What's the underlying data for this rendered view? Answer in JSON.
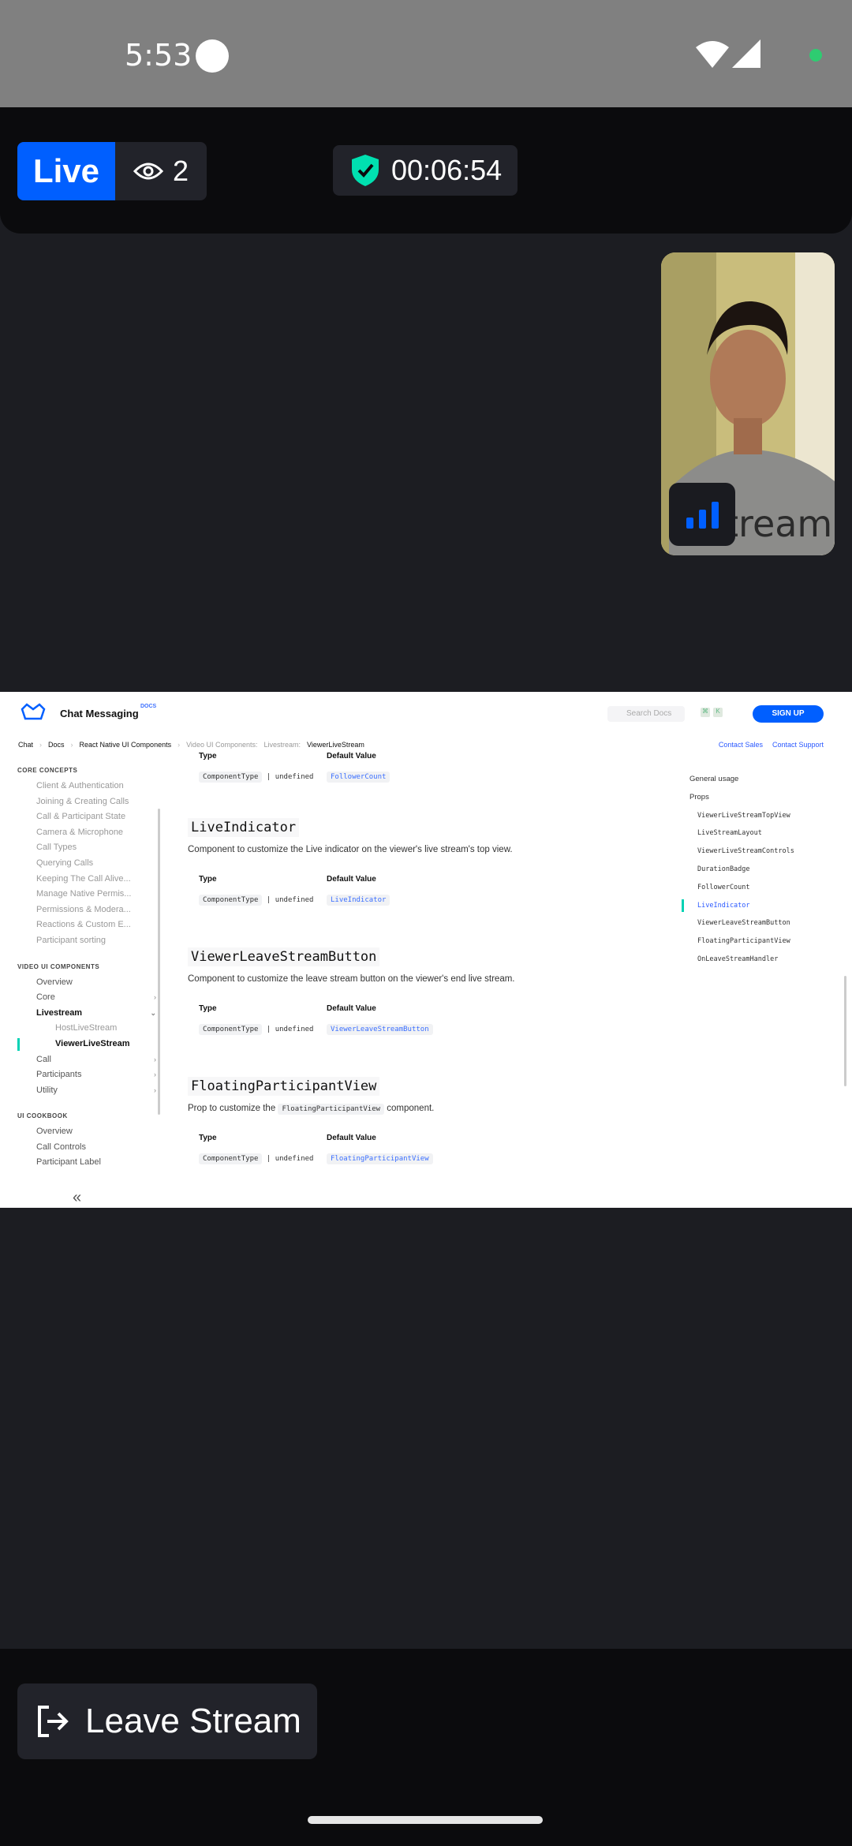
{
  "status_bar": {
    "time": "5:53"
  },
  "stream_header": {
    "live_label": "Live",
    "viewer_count": "2",
    "duration": "00:06:54"
  },
  "self_view": {
    "network_icon": "signal-bars-icon"
  },
  "shared_screen": {
    "brand": "Chat Messaging",
    "brand_sup": "DOCS",
    "search_placeholder": "Search Docs",
    "kbd_1": "⌘",
    "kbd_2": "K",
    "signup": "SIGN UP",
    "breadcrumbs": [
      "Chat",
      "Docs",
      "React Native UI Components",
      "Video UI Components:",
      "Livestream:",
      "ViewerLiveStream"
    ],
    "contact_sales": "Contact Sales",
    "contact_support": "Contact Support",
    "sidebar": {
      "core_title": "CORE CONCEPTS",
      "core_items": [
        "Client & Authentication",
        "Joining & Creating Calls",
        "Call & Participant State",
        "Camera & Microphone",
        "Call Types",
        "Querying Calls",
        "Keeping The Call Alive...",
        "Manage Native Permis...",
        "Permissions & Modera...",
        "Reactions & Custom E...",
        "Participant sorting"
      ],
      "video_title": "VIDEO UI COMPONENTS",
      "video_items": [
        "Overview",
        "Core",
        "Livestream",
        "HostLiveStream",
        "ViewerLiveStream",
        "Call",
        "Participants",
        "Utility"
      ],
      "cookbook_title": "UI COOKBOOK",
      "cookbook_items": [
        "Overview",
        "Call Controls",
        "Participant Label"
      ],
      "collapse": "«"
    },
    "table": {
      "type_header": "Type",
      "default_header": "Default Value",
      "component_type": "ComponentType",
      "undefined": "| undefined"
    },
    "blocks": [
      {
        "default": "FollowerCount"
      },
      {
        "title": "LiveIndicator",
        "desc": "Component to customize the Live indicator on the viewer's live stream's top view.",
        "default": "LiveIndicator"
      },
      {
        "title": "ViewerLeaveStreamButton",
        "desc": "Component to customize the leave stream button on the viewer's end live stream.",
        "default": "ViewerLeaveStreamButton"
      },
      {
        "title": "FloatingParticipantView",
        "desc_pre": "Prop to customize the",
        "desc_code": "FloatingParticipantView",
        "desc_post": "component.",
        "default": "FloatingParticipantView"
      }
    ],
    "toc": {
      "general": "General usage",
      "props": "Props",
      "items": [
        "ViewerLiveStreamTopView",
        "LiveStreamLayout",
        "ViewerLiveStreamControls",
        "DurationBadge",
        "FollowerCount",
        "LiveIndicator",
        "ViewerLeaveStreamButton",
        "FloatingParticipantView",
        "OnLeaveStreamHandler"
      ]
    }
  },
  "footer": {
    "leave_label": "Leave Stream"
  },
  "colors": {
    "accent": "#005fff",
    "shield": "#00e0b0",
    "bg": "#1c1d22",
    "bar": "#0b0b0d"
  }
}
